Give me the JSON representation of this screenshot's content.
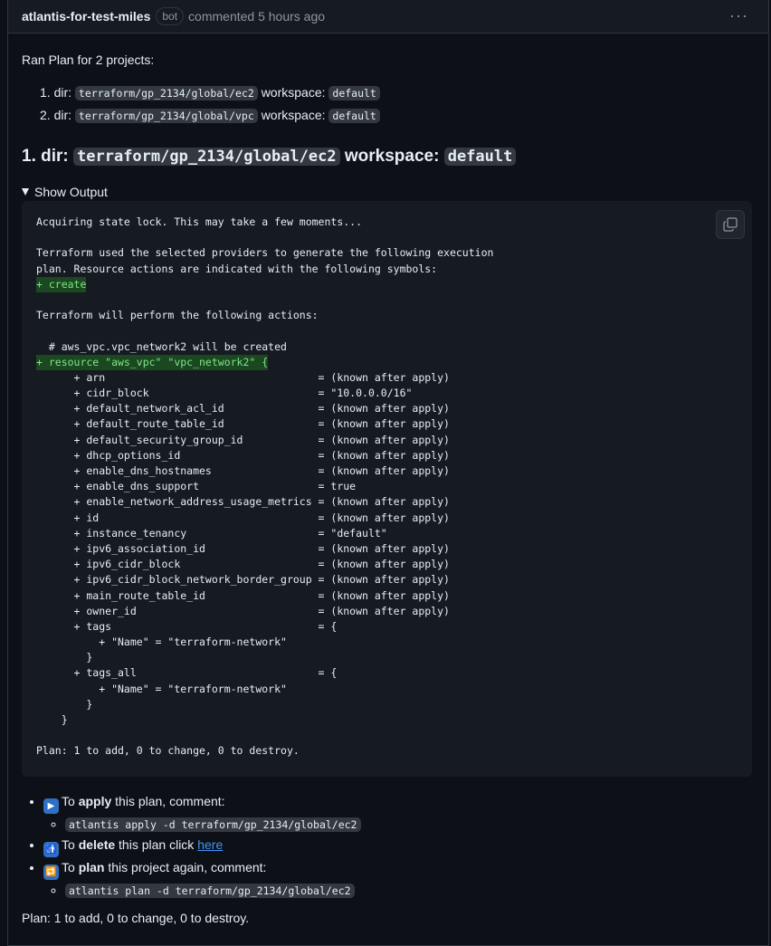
{
  "comment": {
    "author": "atlantis-for-test-miles",
    "badge": "bot",
    "meta": "commented 5 hours ago",
    "menu_icon": "kebab-horizontal-icon"
  },
  "intro": "Ran Plan for 2 projects:",
  "projects": [
    {
      "num": "1.",
      "dir_label": "dir:",
      "dir": "terraform/gp_2134/global/ec2",
      "ws_label": "workspace:",
      "ws": "default"
    },
    {
      "num": "2.",
      "dir_label": "dir:",
      "dir": "terraform/gp_2134/global/vpc",
      "ws_label": "workspace:",
      "ws": "default"
    }
  ],
  "heading": {
    "prefix": "1. dir:",
    "dir": "terraform/gp_2134/global/ec2",
    "ws_label": "workspace:",
    "ws": "default"
  },
  "details": {
    "summary": "Show Output"
  },
  "output_lines": [
    {
      "t": "Acquiring state lock. This may take a few moments..."
    },
    {
      "t": ""
    },
    {
      "t": "Terraform used the selected providers to generate the following execution"
    },
    {
      "t": "plan. Resource actions are indicated with the following symbols:"
    },
    {
      "t": "+ create",
      "add": true
    },
    {
      "t": ""
    },
    {
      "t": "Terraform will perform the following actions:"
    },
    {
      "t": ""
    },
    {
      "t": "  # aws_vpc.vpc_network2 will be created"
    },
    {
      "t": "+ resource \"aws_vpc\" \"vpc_network2\" {",
      "add": true
    },
    {
      "t": "      + arn                                  = (known after apply)"
    },
    {
      "t": "      + cidr_block                           = \"10.0.0.0/16\""
    },
    {
      "t": "      + default_network_acl_id               = (known after apply)"
    },
    {
      "t": "      + default_route_table_id               = (known after apply)"
    },
    {
      "t": "      + default_security_group_id            = (known after apply)"
    },
    {
      "t": "      + dhcp_options_id                      = (known after apply)"
    },
    {
      "t": "      + enable_dns_hostnames                 = (known after apply)"
    },
    {
      "t": "      + enable_dns_support                   = true"
    },
    {
      "t": "      + enable_network_address_usage_metrics = (known after apply)"
    },
    {
      "t": "      + id                                   = (known after apply)"
    },
    {
      "t": "      + instance_tenancy                     = \"default\""
    },
    {
      "t": "      + ipv6_association_id                  = (known after apply)"
    },
    {
      "t": "      + ipv6_cidr_block                      = (known after apply)"
    },
    {
      "t": "      + ipv6_cidr_block_network_border_group = (known after apply)"
    },
    {
      "t": "      + main_route_table_id                  = (known after apply)"
    },
    {
      "t": "      + owner_id                             = (known after apply)"
    },
    {
      "t": "      + tags                                 = {"
    },
    {
      "t": "          + \"Name\" = \"terraform-network\""
    },
    {
      "t": "        }"
    },
    {
      "t": "      + tags_all                             = {"
    },
    {
      "t": "          + \"Name\" = \"terraform-network\""
    },
    {
      "t": "        }"
    },
    {
      "t": "    }"
    },
    {
      "t": ""
    },
    {
      "t": "Plan: 1 to add, 0 to change, 0 to destroy."
    }
  ],
  "actions": {
    "apply": {
      "icon": "play-button-icon",
      "pre": "To",
      "bold": "apply",
      "post": "this plan, comment:",
      "command": "atlantis apply -d terraform/gp_2134/global/ec2"
    },
    "delete": {
      "icon": "put-litter-icon",
      "pre": "To",
      "bold": "delete",
      "post": "this plan click",
      "link": "here"
    },
    "plan": {
      "icon": "repeat-arrows-icon",
      "pre": "To",
      "bold": "plan",
      "post": "this project again, comment:",
      "command": "atlantis plan -d terraform/gp_2134/global/ec2"
    }
  },
  "footer": "Plan: 1 to add, 0 to change, 0 to destroy."
}
